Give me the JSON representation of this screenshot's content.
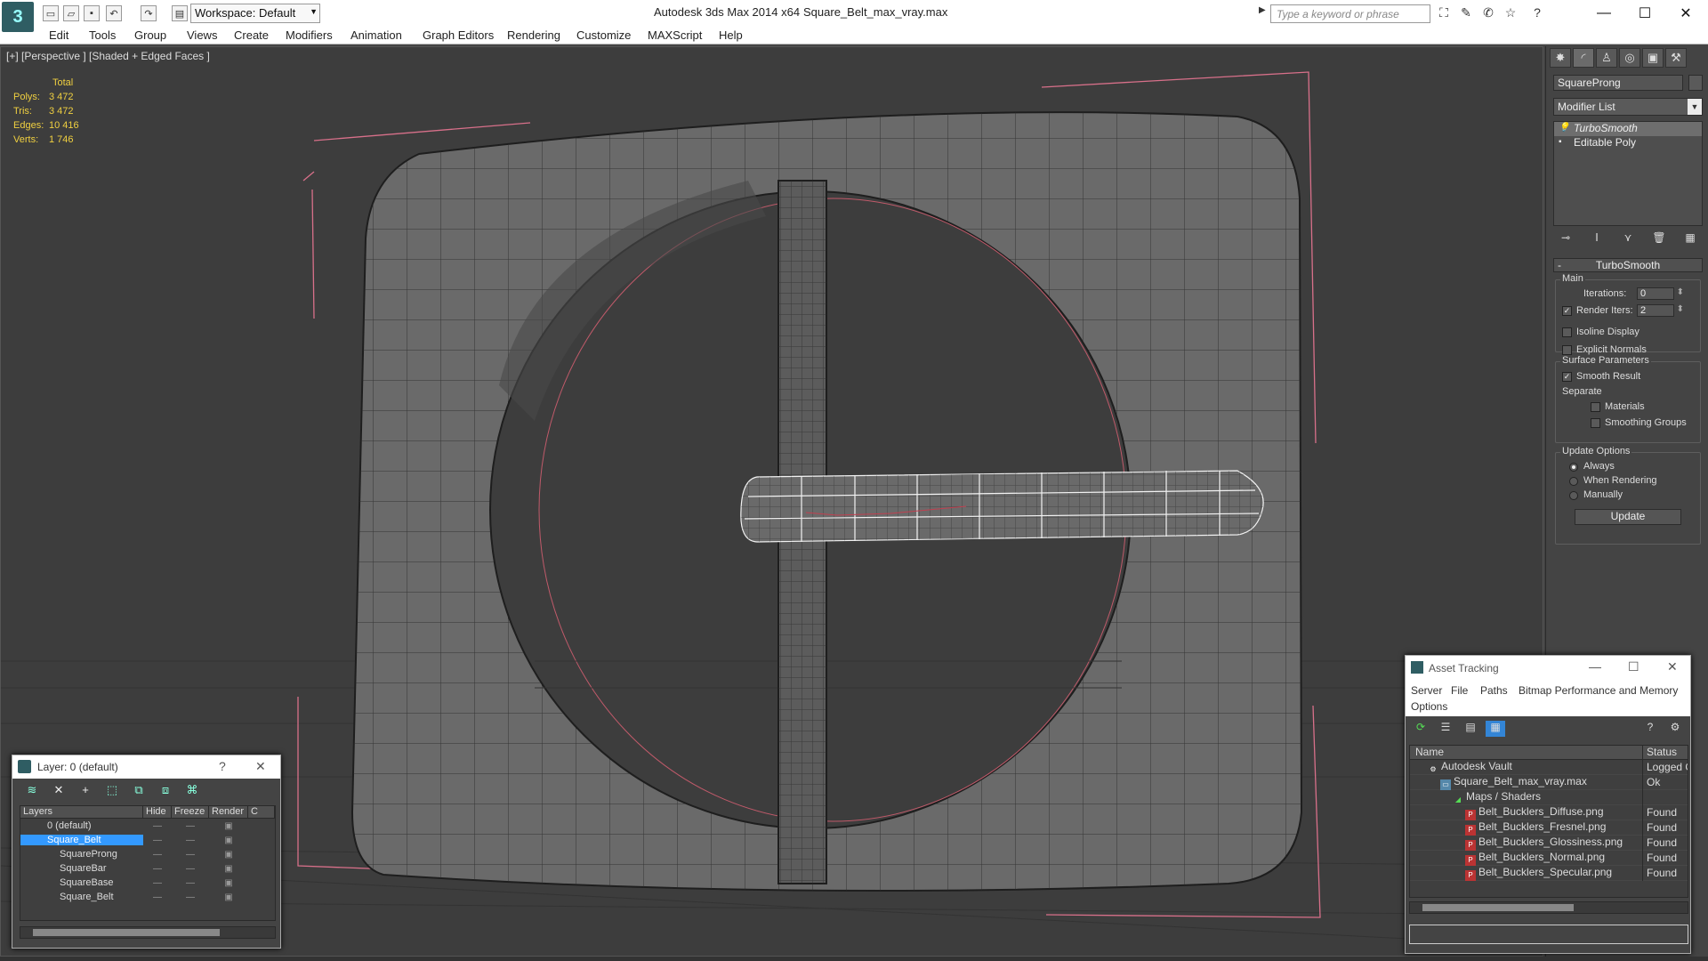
{
  "titlebar": {
    "workspace": "Workspace: Default",
    "app_title": "Autodesk 3ds Max  2014 x64",
    "file_title": "Square_Belt_max_vray.max",
    "search_placeholder": "Type a keyword or phrase"
  },
  "menu": [
    "Edit",
    "Tools",
    "Group",
    "Views",
    "Create",
    "Modifiers",
    "Animation",
    "Graph Editors",
    "Rendering",
    "Customize",
    "MAXScript",
    "Help"
  ],
  "viewport": {
    "label": "[+] [Perspective ] [Shaded + Edged Faces ]",
    "stats_header": "Total",
    "stats": [
      {
        "key": "Polys:",
        "value": "3 472"
      },
      {
        "key": "Tris:",
        "value": "3 472"
      },
      {
        "key": "Edges:",
        "value": "10 416"
      },
      {
        "key": "Verts:",
        "value": "1 746"
      }
    ]
  },
  "command_panel": {
    "object_name": "SquareProng",
    "modifier_list": "Modifier List",
    "stack": [
      "TurboSmooth",
      "Editable Poly"
    ],
    "rollout_title": "TurboSmooth",
    "main_label": "Main",
    "iterations_label": "Iterations:",
    "iterations_value": "0",
    "render_iters_label": "Render Iters:",
    "render_iters_value": "2",
    "isoline_label": "Isoline Display",
    "explicit_normals_label": "Explicit Normals",
    "surface_params_label": "Surface Parameters",
    "smooth_result_label": "Smooth Result",
    "separate_label": "Separate",
    "materials_label": "Materials",
    "smoothing_groups_label": "Smoothing Groups",
    "update_options_label": "Update Options",
    "always_label": "Always",
    "when_rendering_label": "When Rendering",
    "manually_label": "Manually",
    "update_button": "Update"
  },
  "layer_dialog": {
    "title": "Layer: 0 (default)",
    "columns": [
      "Layers",
      "Hide",
      "Freeze",
      "Render",
      "C"
    ],
    "rows": [
      "0 (default)",
      "Square_Belt",
      "SquareProng",
      "SquareBar",
      "SquareBase",
      "Square_Belt"
    ]
  },
  "asset_dialog": {
    "title": "Asset Tracking",
    "menu": [
      "Server",
      "File",
      "Paths",
      "Bitmap Performance and Memory",
      "Options"
    ],
    "columns": [
      "Name",
      "Status"
    ],
    "rows": [
      {
        "name": "Autodesk Vault",
        "status": "Logged C"
      },
      {
        "name": "Square_Belt_max_vray.max",
        "status": "Ok"
      },
      {
        "name": "Maps / Shaders",
        "status": ""
      },
      {
        "name": "Belt_Bucklers_Diffuse.png",
        "status": "Found"
      },
      {
        "name": "Belt_Bucklers_Fresnel.png",
        "status": "Found"
      },
      {
        "name": "Belt_Bucklers_Glossiness.png",
        "status": "Found"
      },
      {
        "name": "Belt_Bucklers_Normal.png",
        "status": "Found"
      },
      {
        "name": "Belt_Bucklers_Specular.png",
        "status": "Found"
      }
    ]
  }
}
